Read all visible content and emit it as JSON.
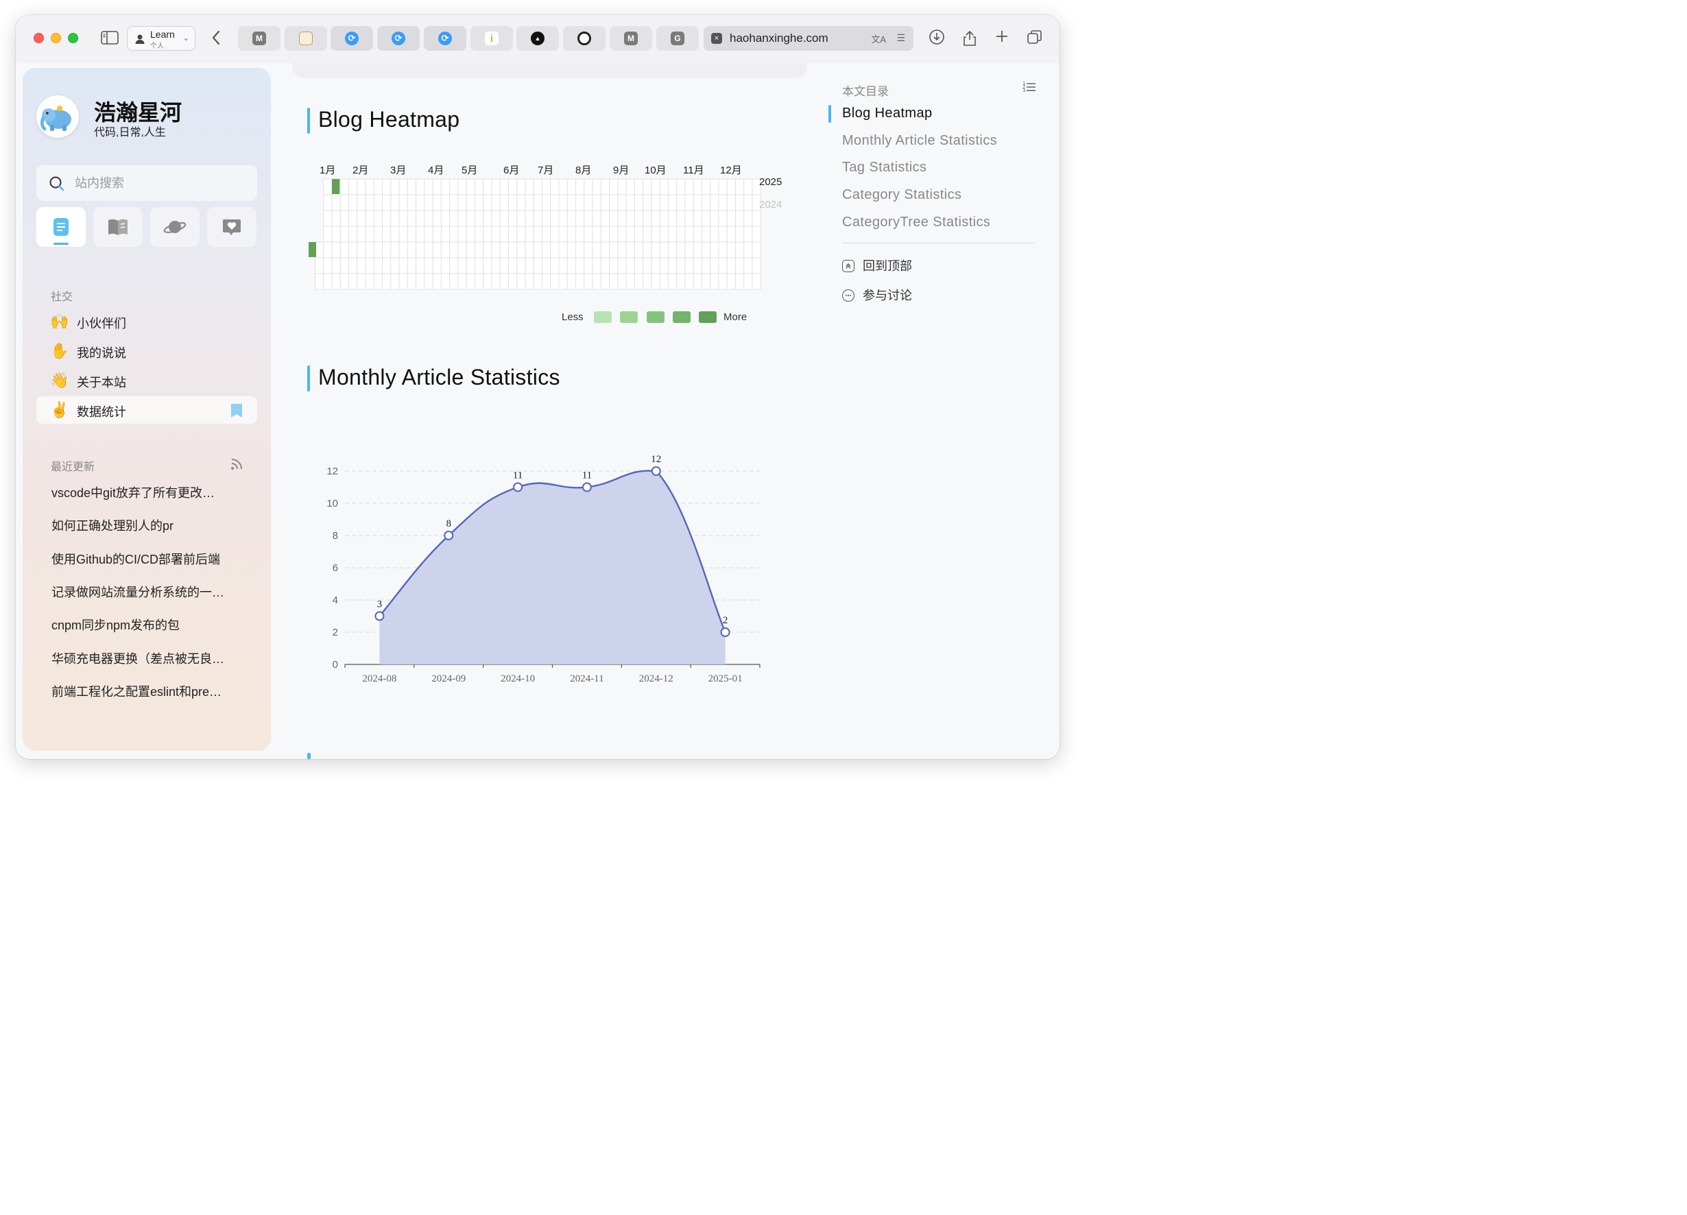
{
  "browser": {
    "profile": {
      "name": "Learn",
      "sub": "个人"
    },
    "tabs": [
      {
        "icon": "m-icon",
        "letter": "M",
        "color": "#7a7a7a"
      },
      {
        "icon": "koala-icon",
        "letter": "",
        "color": "#f3e7d6"
      },
      {
        "icon": "sync-icon",
        "letter": "",
        "color": "#3b9cf5"
      },
      {
        "icon": "sync-icon",
        "letter": "",
        "color": "#3b9cf5"
      },
      {
        "icon": "sync-icon",
        "letter": "",
        "color": "#3b9cf5"
      },
      {
        "icon": "info-icon",
        "letter": "i",
        "color": "#8cd348"
      },
      {
        "icon": "triangle-icon",
        "letter": "",
        "color": "#111111"
      },
      {
        "icon": "github-icon",
        "letter": "",
        "color": "#222222"
      },
      {
        "icon": "m-icon",
        "letter": "M",
        "color": "#7a7a7a"
      },
      {
        "icon": "g-icon",
        "letter": "G",
        "color": "#7a7a7a"
      }
    ],
    "url": "haohanxinghe.com"
  },
  "sidebar": {
    "title": "浩瀚星河",
    "subtitle": "代码,日常,人生",
    "search_placeholder": "站内搜索",
    "social_label": "社交",
    "social_items": [
      {
        "emoji": "🙌",
        "label": "小伙伴们"
      },
      {
        "emoji": "✋",
        "label": "我的说说"
      },
      {
        "emoji": "👋",
        "label": "关于本站"
      },
      {
        "emoji": "✌️",
        "label": "数据统计"
      }
    ],
    "recent_label": "最近更新",
    "recent_items": [
      "vscode中git放弃了所有更改…",
      "如何正确处理别人的pr",
      "使用Github的CI/CD部署前后端",
      "记录做网站流量分析系统的一…",
      "cnpm同步npm发布的包",
      "华硕充电器更换（差点被无良…",
      "前端工程化之配置eslint和pre…"
    ]
  },
  "main": {
    "heatmap_title": "Blog Heatmap",
    "months": [
      "1月",
      "2月",
      "3月",
      "4月",
      "5月",
      "6月",
      "7月",
      "8月",
      "9月",
      "10月",
      "11月",
      "12月"
    ],
    "years": [
      "2025",
      "2024"
    ],
    "legend_less": "Less",
    "legend_more": "More",
    "legend_colors": [
      "#b7e3b0",
      "#9dd494",
      "#86c47d",
      "#73b36a",
      "#62a058"
    ],
    "monthly_title": "Monthly Article Statistics"
  },
  "chart_data": {
    "type": "area",
    "categories": [
      "2024-08",
      "2024-09",
      "2024-10",
      "2024-11",
      "2024-12",
      "2025-01"
    ],
    "values": [
      3,
      8,
      11,
      11,
      12,
      2
    ],
    "ylim": [
      0,
      12
    ],
    "yticks": [
      0,
      2,
      4,
      6,
      8,
      10,
      12
    ],
    "grid": true,
    "line_color": "#5566bb",
    "fill_color": "#c9d1ea"
  },
  "toc": {
    "title": "本文目录",
    "items": [
      "Blog Heatmap",
      "Monthly Article Statistics",
      "Tag Statistics",
      "Category Statistics",
      "CategoryTree Statistics"
    ],
    "back_to_top": "回到顶部",
    "discuss": "参与讨论"
  }
}
